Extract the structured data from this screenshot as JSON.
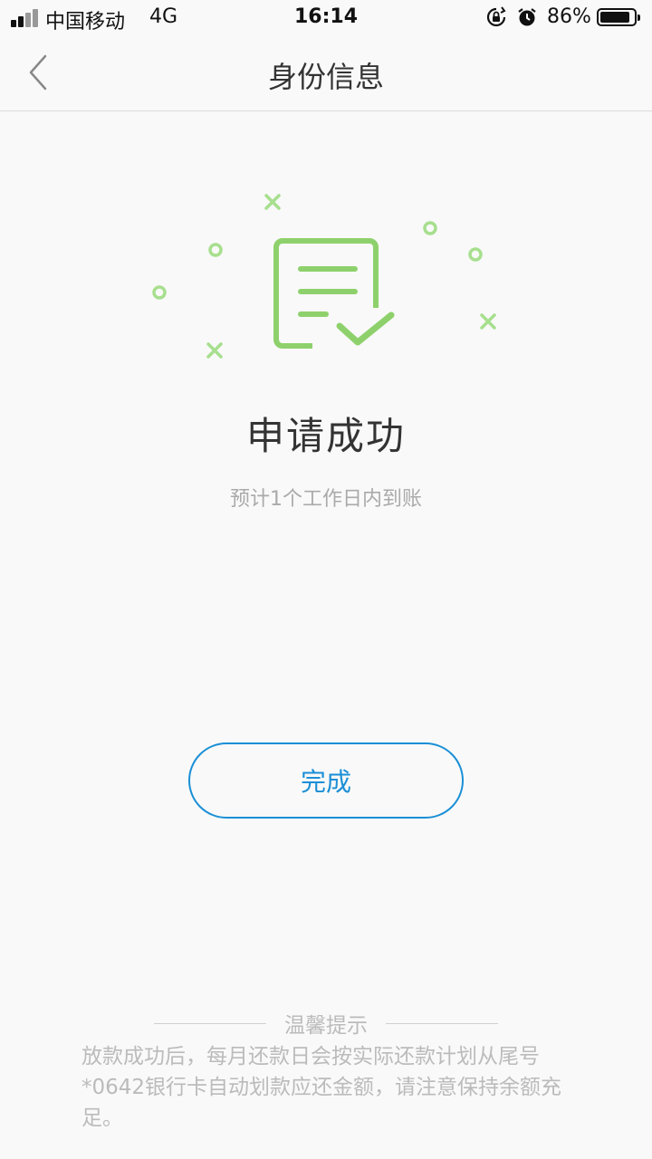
{
  "status_bar": {
    "carrier": "中国移动",
    "network": "4G",
    "time": "16:14",
    "battery_percent": "86%",
    "battery_level": 0.86,
    "icons": [
      "signal-icon",
      "rotation-lock-icon",
      "alarm-icon",
      "battery-icon"
    ]
  },
  "navbar": {
    "back_icon": "chevron-left-icon",
    "title": "身份信息"
  },
  "result": {
    "icon": "document-check-icon",
    "title": "申请成功",
    "subtitle": "预计1个工作日内到账"
  },
  "actions": {
    "done_label": "完成"
  },
  "tips": {
    "heading": "温馨提示",
    "body": "放款成功后，每月还款日会按实际还款计划从尾号*0642银行卡自动划款应还金额，请注意保持余额充足。"
  },
  "colors": {
    "accent": "#1b8fd6",
    "success_green": "#8ed16c",
    "decor_green": "#a7df8e",
    "muted_text": "#bbbbbb"
  }
}
